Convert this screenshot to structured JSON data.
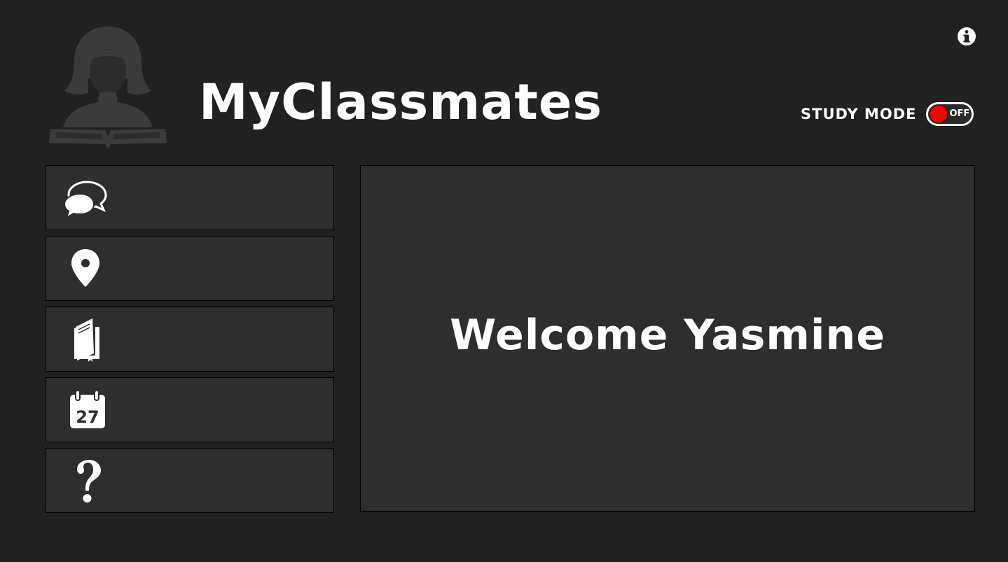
{
  "header": {
    "app_title": "MyClassmates",
    "avatar_icon": "student-reading-avatar-icon",
    "info_icon": "info-icon"
  },
  "study_mode": {
    "label": "STUDY MODE",
    "state": "OFF",
    "knob_color": "#ff0000"
  },
  "sidebar": {
    "items": [
      {
        "icon": "chat-bubbles-icon",
        "label": ""
      },
      {
        "icon": "location-pin-icon",
        "label": ""
      },
      {
        "icon": "book-icon",
        "label": ""
      },
      {
        "icon": "calendar-icon",
        "label": "",
        "icon_text": "27"
      },
      {
        "icon": "question-mark-icon",
        "label": ""
      }
    ]
  },
  "main": {
    "welcome_text": "Welcome Yasmine"
  },
  "colors": {
    "background": "#212121",
    "panel": "#2e2e2e",
    "text": "#ffffff",
    "avatar": "#3a3a3a"
  }
}
